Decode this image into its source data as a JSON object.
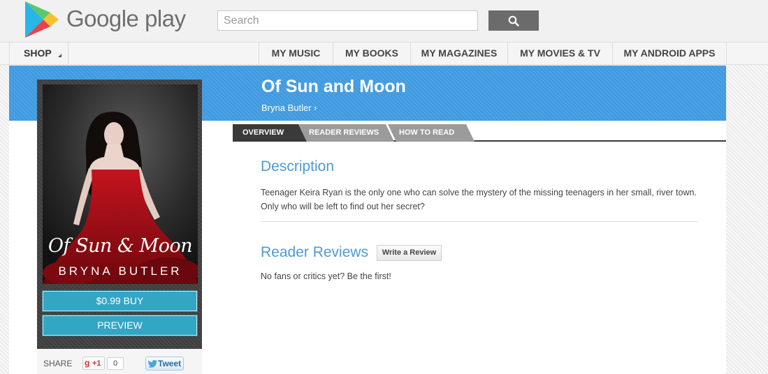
{
  "brand": {
    "name": "Google play"
  },
  "search": {
    "placeholder": "Search"
  },
  "nav": {
    "shop": "SHOP",
    "items": [
      {
        "label": "MY MUSIC"
      },
      {
        "label": "MY BOOKS"
      },
      {
        "label": "MY MAGAZINES"
      },
      {
        "label": "MY MOVIES & TV"
      },
      {
        "label": "MY ANDROID APPS"
      }
    ]
  },
  "book": {
    "title": "Of Sun and Moon",
    "author_link": "Bryna Butler ›",
    "cover_title": "Of Sun & Moon",
    "cover_author": "BRYNA BUTLER"
  },
  "actions": {
    "buy": "$0.99 BUY",
    "preview": "PREVIEW"
  },
  "share": {
    "label": "SHARE",
    "gplus": "+1",
    "gplus_count": "0",
    "tweet": "Tweet"
  },
  "tabs": [
    {
      "label": "OVERVIEW"
    },
    {
      "label": "READER REVIEWS"
    },
    {
      "label": "HOW TO READ"
    }
  ],
  "description": {
    "heading": "Description",
    "text": "Teenager Keira Ryan is the only one who can solve the mystery of the missing teenagers in her small, river town. Only who will be left to find out her secret?"
  },
  "reviews": {
    "heading": "Reader Reviews",
    "write_button": "Write a Review",
    "empty_text": "No fans or critics yet? Be the first!"
  },
  "colors": {
    "hero_blue": "#3f9ae0",
    "teal_button": "#33a6c4",
    "heading_blue": "#4d9ad6",
    "tab_active": "#3a3a3a",
    "tab_inactive": "#9b9b9b"
  }
}
